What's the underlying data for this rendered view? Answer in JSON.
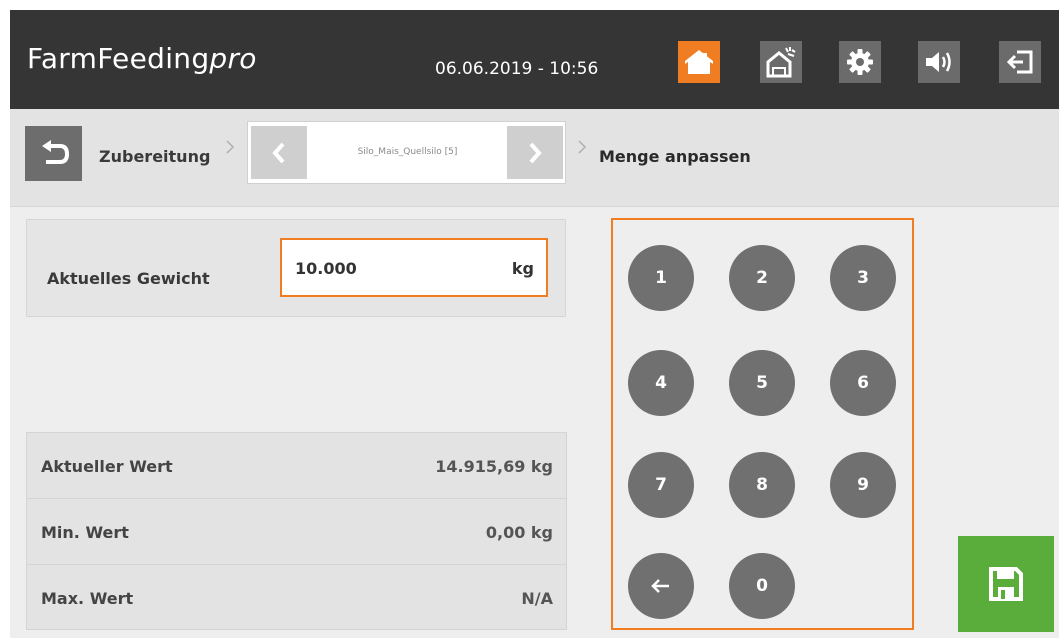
{
  "header": {
    "brand_main": "FarmFeeding",
    "brand_suffix": "pro",
    "datetime": "06.06.2019 - 10:56",
    "icons": [
      "home-icon",
      "feed-barn-icon",
      "gear-icon",
      "speaker-icon",
      "logout-icon"
    ],
    "accent_color": "#f07d21"
  },
  "breadcrumb": {
    "back_icon": "undo-arrow-icon",
    "parent": "Zubereitung",
    "silo": "Silo_Mais_Quellsilo [5]",
    "current": "Menge anpassen"
  },
  "weight": {
    "label": "Aktuelles Gewicht",
    "value": "10.000",
    "unit": "kg"
  },
  "info": {
    "rows": [
      {
        "label": "Aktueller Wert",
        "value": "14.915,69 kg"
      },
      {
        "label": "Min. Wert",
        "value": "0,00 kg"
      },
      {
        "label": "Max. Wert",
        "value": "N/A"
      }
    ]
  },
  "keypad": {
    "keys": [
      "1",
      "2",
      "3",
      "4",
      "5",
      "6",
      "7",
      "8",
      "9",
      "0"
    ],
    "backspace_icon": "backspace-arrow-icon"
  },
  "save": {
    "icon": "floppy-disk-icon",
    "color": "#5aad3a"
  }
}
